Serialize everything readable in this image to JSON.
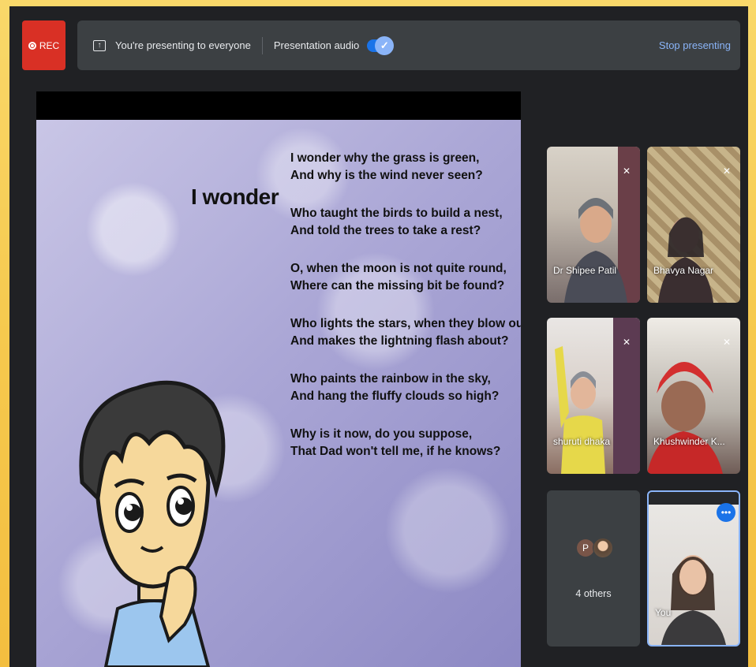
{
  "recording": {
    "label": "REC"
  },
  "presenting": {
    "message": "You're presenting to everyone",
    "audio_label": "Presentation audio",
    "audio_enabled": true,
    "stop_label": "Stop presenting"
  },
  "slide": {
    "title": "I wonder",
    "stanzas": [
      [
        "I wonder why the grass is green,",
        "And why is the wind never seen?"
      ],
      [
        "Who taught the birds to build a nest,",
        "And told the trees to take a rest?"
      ],
      [
        "O, when the moon is not quite round,",
        "Where can the missing bit be found?"
      ],
      [
        "Who lights the stars, when they blow out,",
        "And makes the lightning flash about?"
      ],
      [
        "Who paints the rainbow in the sky,",
        "And hang the fluffy clouds so high?"
      ],
      [
        "Why is it now, do you suppose,",
        "That Dad won't tell me, if he knows?"
      ]
    ]
  },
  "participants": [
    {
      "name": "Dr Shipee Patil",
      "muted": true
    },
    {
      "name": "Bhavya Nagar",
      "muted": true
    },
    {
      "name": "shuruti dhaka",
      "muted": true
    },
    {
      "name": "Khushwinder K...",
      "muted": true
    },
    {
      "name": "4 others",
      "avatar_initial": "P"
    },
    {
      "name": "You"
    }
  ],
  "colors": {
    "rec": "#d93025",
    "accent": "#8ab4f8",
    "toggle": "#1a73e8",
    "bar": "#3c4043",
    "background": "#202124"
  }
}
